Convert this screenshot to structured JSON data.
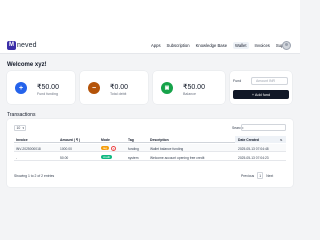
{
  "brand": {
    "badge": "M",
    "name": "neved"
  },
  "nav": {
    "items": [
      "Apps",
      "Subscription",
      "Knowledge Base",
      "Wallet",
      "Invoices",
      "Support"
    ],
    "active": "Wallet"
  },
  "welcome": "Welcome xyz!",
  "cards": [
    {
      "icon": "plus-icon",
      "glyph": "+",
      "color": "#2563eb",
      "amount": "₹50.00",
      "label": "Fund funding"
    },
    {
      "icon": "minus-icon",
      "glyph": "−",
      "color": "#b45309",
      "amount": "₹0.00",
      "label": "Total debit"
    },
    {
      "icon": "wallet-icon",
      "glyph": "▣",
      "color": "#16a34a",
      "amount": "₹50.00",
      "label": "Balance"
    }
  ],
  "fund": {
    "label": "Fund",
    "placeholder": "Amount INR",
    "button": "+ Add fund"
  },
  "transactions": {
    "title": "Transactions",
    "page_length": "10",
    "search_label": "Search:",
    "columns": [
      "Invoice",
      "Amount ( ₹ )",
      "Mode",
      "Tag",
      "Description",
      "Date Created"
    ],
    "rows": [
      {
        "invoice": "INV-2025000018",
        "amount": "1000.00",
        "mode": "tag",
        "tag": "funding",
        "description": "Wallet balance funding",
        "date": "2025-05-13 07:04:48"
      },
      {
        "invoice": "-",
        "amount": "50.00",
        "mode": "credit",
        "tag": "system",
        "description": "Welcome account opening free credit",
        "date": "2025-05-13 07:04:23"
      }
    ],
    "showing": "Showing 1 to 2 of 2 entries",
    "pager": {
      "prev": "Previous",
      "page": "1",
      "next": "Next"
    }
  }
}
